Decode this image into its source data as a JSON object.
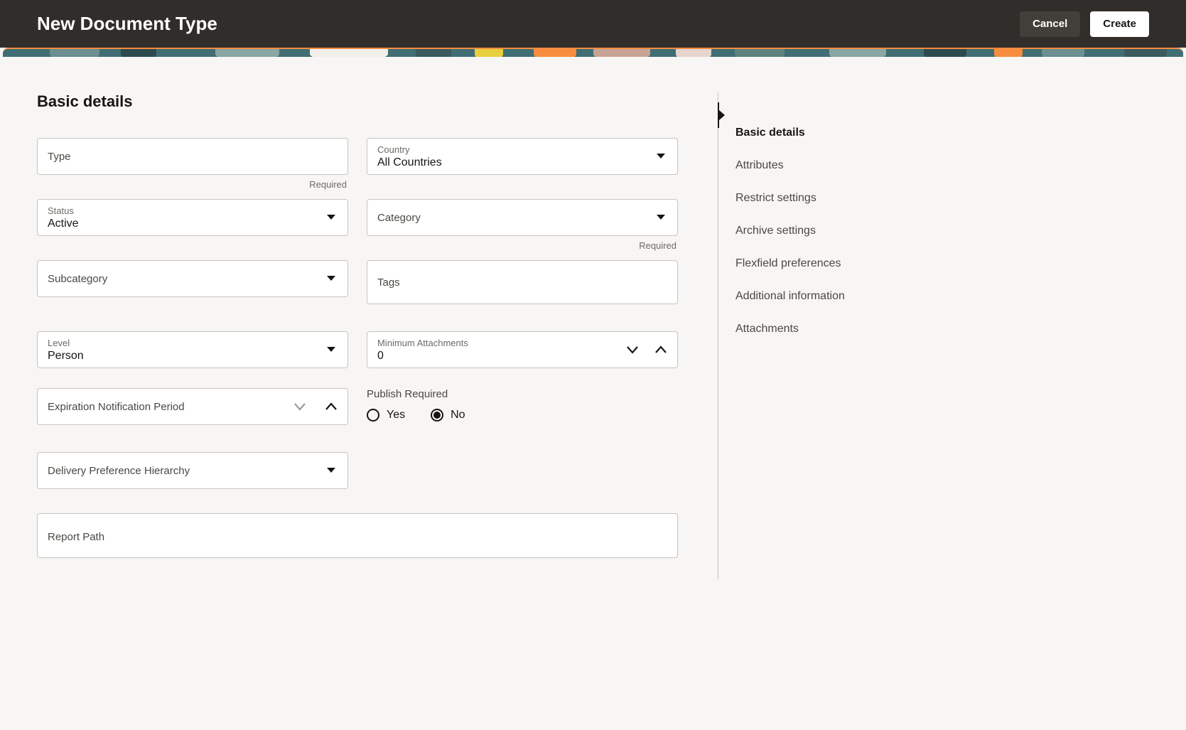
{
  "header": {
    "title": "New Document Type",
    "cancel": "Cancel",
    "create": "Create"
  },
  "section": {
    "title": "Basic details"
  },
  "fields": {
    "type": {
      "label": "Type",
      "value": "",
      "required_hint": "Required"
    },
    "country": {
      "label": "Country",
      "value": "All Countries"
    },
    "status": {
      "label": "Status",
      "value": "Active"
    },
    "category": {
      "label": "Category",
      "value": "",
      "required_hint": "Required"
    },
    "subcategory": {
      "label": "Subcategory",
      "value": ""
    },
    "tags": {
      "label": "Tags",
      "value": ""
    },
    "level": {
      "label": "Level",
      "value": "Person"
    },
    "min_attach": {
      "label": "Minimum Attachments",
      "value": "0"
    },
    "exp_notif": {
      "label": "Expiration Notification Period",
      "value": ""
    },
    "publish_required": {
      "label": "Publish Required",
      "yes": "Yes",
      "no": "No",
      "selected": "no"
    },
    "delivery_pref": {
      "label": "Delivery Preference Hierarchy",
      "value": ""
    },
    "report_path": {
      "label": "Report Path",
      "value": ""
    }
  },
  "sidenav": {
    "items": [
      "Basic details",
      "Attributes",
      "Restrict settings",
      "Archive settings",
      "Flexfield preferences",
      "Additional information",
      "Attachments"
    ],
    "active_index": 0
  }
}
